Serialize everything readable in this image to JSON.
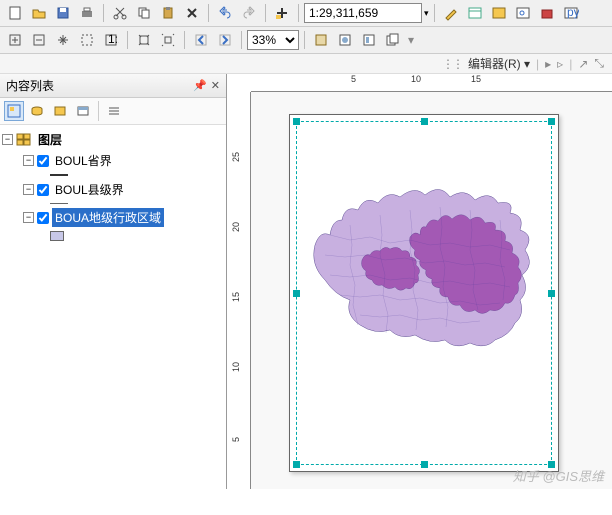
{
  "toolbar": {
    "scale": "1:29,311,659",
    "zoom": "33%"
  },
  "editor": {
    "label": "编辑器(R)"
  },
  "toc": {
    "title": "内容列表",
    "root": "图层",
    "layers": [
      {
        "name": "BOUL省界",
        "checked": true
      },
      {
        "name": "BOUL县级界",
        "checked": true
      },
      {
        "name": "BOUA地级行政区域",
        "checked": true,
        "selected": true
      }
    ]
  },
  "ruler": {
    "h": [
      "5",
      "10",
      "15"
    ],
    "v": [
      "25",
      "20",
      "15",
      "10",
      "5"
    ]
  },
  "watermark": "知乎 @GIS思维"
}
